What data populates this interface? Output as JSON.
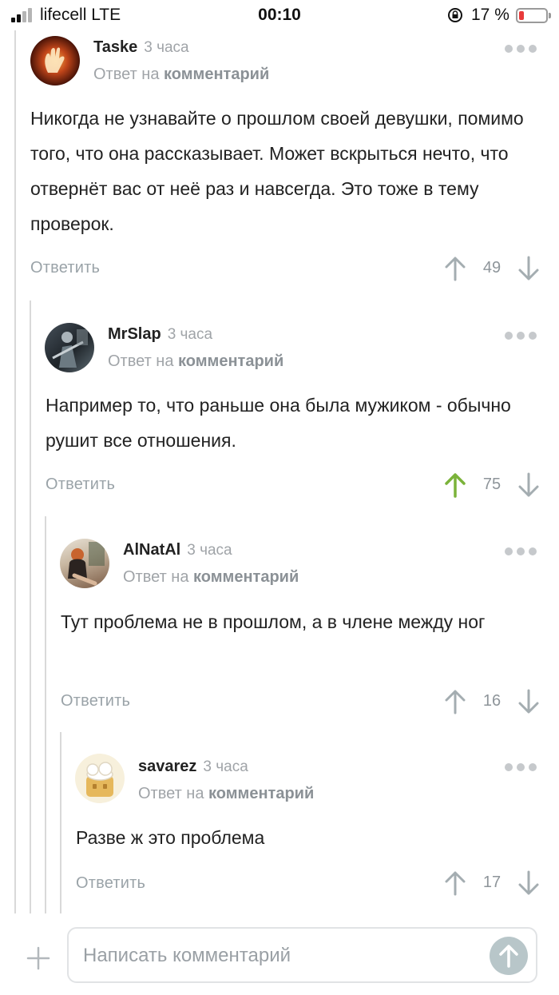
{
  "status_bar": {
    "carrier": "lifecell  LTE",
    "time": "00:10",
    "battery": "17 %"
  },
  "reply_label": "Ответ на",
  "comment_link": "комментарий",
  "reply_button": "Ответить",
  "comments": [
    {
      "author": "Taske",
      "time": "3 часа",
      "text": "Никогда не узнавайте о прошлом своей девушки, помимо того, что она рассказывает. Может вскрыться нечто, что отвернёт вас от неё раз и навсегда. Это тоже в тему проверок.",
      "score": "49"
    },
    {
      "author": "MrSlap",
      "time": "3 часа",
      "text": "Например то, что раньше она была мужиком - обычно рушит все отношения.",
      "score": "75",
      "upvoted": true
    },
    {
      "author": "AlNatAl",
      "time": "3 часа",
      "text": "Тут проблема не в прошлом, а в члене между ног",
      "score": "16"
    },
    {
      "author": "savarez",
      "time": "3 часа",
      "text": "Разве ж это проблема",
      "score": "17"
    }
  ],
  "composer": {
    "placeholder": "Написать комментарий"
  },
  "colors": {
    "upvote_active": "#7bb33a",
    "muted": "#a0a4a8",
    "rail": "#d9d9d9"
  }
}
